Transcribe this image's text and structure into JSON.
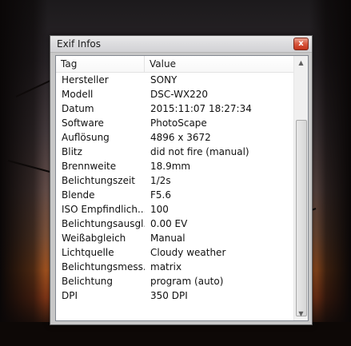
{
  "window": {
    "title": "Exif Infos",
    "close_label": "x"
  },
  "table": {
    "headers": {
      "tag": "Tag",
      "value": "Value"
    },
    "rows": [
      {
        "tag": "Hersteller",
        "value": "SONY"
      },
      {
        "tag": "Modell",
        "value": "DSC-WX220"
      },
      {
        "tag": "Datum",
        "value": "2015:11:07 18:27:34"
      },
      {
        "tag": "Software",
        "value": "PhotoScape"
      },
      {
        "tag": "Auflösung",
        "value": "4896 x 3672"
      },
      {
        "tag": "Blitz",
        "value": "did not fire (manual)"
      },
      {
        "tag": "Brennweite",
        "value": "18.9mm"
      },
      {
        "tag": "Belichtungszeit",
        "value": "1/2s"
      },
      {
        "tag": "Blende",
        "value": "F5.6"
      },
      {
        "tag": "ISO Empfindlich...",
        "value": "100"
      },
      {
        "tag": "Belichtungsausgl...",
        "value": "0.00 EV"
      },
      {
        "tag": "Weißabgleich",
        "value": "Manual"
      },
      {
        "tag": "Lichtquelle",
        "value": "Cloudy weather"
      },
      {
        "tag": "Belichtungsmess...",
        "value": "matrix"
      },
      {
        "tag": "Belichtung",
        "value": "program (auto)"
      },
      {
        "tag": "DPI",
        "value": "350 DPI"
      }
    ]
  },
  "colors": {
    "close_button": "#c2331a",
    "list_background": "#ffffff"
  }
}
